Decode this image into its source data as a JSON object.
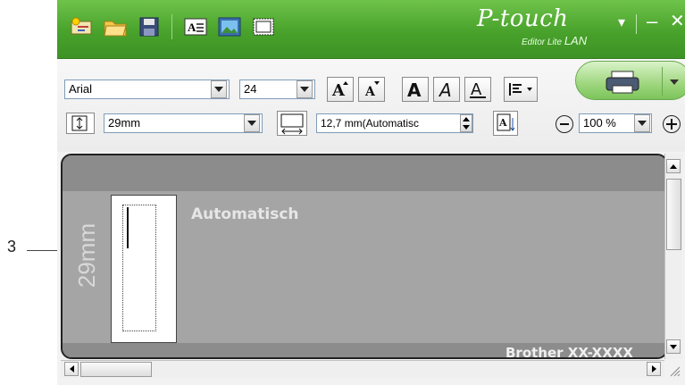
{
  "callout": {
    "number": "3"
  },
  "titlebar": {
    "brand": "P-touch",
    "brand_sub_editor": "Editor Lite",
    "brand_sub_lan": "LAN",
    "menu_arrow": "▾",
    "minimize": "–",
    "close": "✕",
    "icons": [
      "open-label-icon",
      "open-folder-icon",
      "save-icon",
      "text-box-icon",
      "image-icon",
      "frame-icon"
    ]
  },
  "toolbar": {
    "font_value": "Arial",
    "font_size_value": "24",
    "tape_width_value": "29mm",
    "length_value": "12,7 mm(Automatisc",
    "zoom_value": "100 %",
    "format_buttons": [
      "grow-font",
      "shrink-font",
      "bold",
      "italic",
      "underline",
      "align"
    ]
  },
  "editor": {
    "tape_size_label": "29mm",
    "auto_length_label": "Automatisch",
    "printer_name": "Brother XX-XXXX"
  },
  "colors": {
    "title_green": "#48a22b",
    "canvas_gray": "#a5a5a5",
    "canvas_dark": "#8c8c8c"
  }
}
